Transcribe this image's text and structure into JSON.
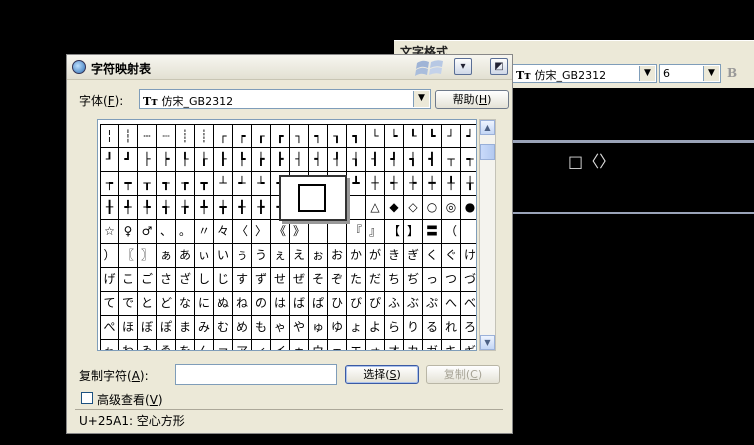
{
  "background_window": {
    "title": "文字格式",
    "font_combo": "仿宋_GB2312",
    "size_combo": "6",
    "bold_label": "B",
    "symbols": "□〈〉"
  },
  "dialog": {
    "title": "字符映射表",
    "font_label": "字体",
    "font_key": "F",
    "font_value": "仿宋_GB2312",
    "help_label": "帮助",
    "help_key": "H",
    "copy_label": "复制字符",
    "copy_key": "A",
    "copy_value": "",
    "select_label": "选择",
    "select_key": "S",
    "copy_button_label": "复制",
    "copy_button_key": "C",
    "advanced_label": "高级查看",
    "advanced_key": "V",
    "advanced_checked": false,
    "status": "U+25A1: 空心方形",
    "zoom_char": "□"
  },
  "grid": {
    "columns": 20,
    "rows": [
      [
        "╎",
        "┆",
        "┄",
        "┈",
        "┊",
        "┊",
        "┌",
        "┍",
        "┎",
        "┏",
        "┐",
        "┑",
        "┒",
        "┓",
        "└",
        "┕",
        "┖",
        "┗",
        "┘",
        "┙"
      ],
      [
        "┚",
        "┛",
        "├",
        "┝",
        "┞",
        "┟",
        "┠",
        "┡",
        "┢",
        "┣",
        "┤",
        "┥",
        "┦",
        "┧",
        "┨",
        "┩",
        "┪",
        "┫",
        "┬",
        "┭"
      ],
      [
        "┮",
        "┯",
        "┰",
        "┱",
        "┲",
        "┳",
        "┴",
        "┵",
        "┶",
        "┷",
        "┸",
        "┹",
        "┺",
        "┻",
        "┼",
        "┽",
        "┾",
        "┿",
        "╀",
        "╁"
      ],
      [
        "╂",
        "╃",
        "╄",
        "╅",
        "╆",
        "╇",
        "╈",
        "╉",
        "╊",
        "╋",
        "",
        "",
        "",
        "",
        "△",
        "◆",
        "◇",
        "○",
        "◎",
        "●",
        "★"
      ],
      [
        "☆",
        "♀",
        "♂",
        "、",
        "。",
        "〃",
        "々",
        "〈",
        "〉",
        "《",
        "》",
        "",
        "",
        "『",
        "』",
        "【",
        "】",
        "〓",
        "（"
      ],
      [
        "）",
        "〖",
        "〗",
        "ぁ",
        "あ",
        "ぃ",
        "い",
        "ぅ",
        "う",
        "ぇ",
        "え",
        "ぉ",
        "お",
        "か",
        "が",
        "き",
        "ぎ",
        "く",
        "ぐ",
        "け"
      ],
      [
        "げ",
        "こ",
        "ご",
        "さ",
        "ざ",
        "し",
        "じ",
        "す",
        "ず",
        "せ",
        "ぜ",
        "そ",
        "ぞ",
        "た",
        "だ",
        "ち",
        "ぢ",
        "っ",
        "つ",
        "づ"
      ],
      [
        "て",
        "で",
        "と",
        "ど",
        "な",
        "に",
        "ぬ",
        "ね",
        "の",
        "は",
        "ば",
        "ぱ",
        "ひ",
        "び",
        "ぴ",
        "ふ",
        "ぶ",
        "ぷ",
        "へ",
        "べ"
      ],
      [
        "ぺ",
        "ほ",
        "ぼ",
        "ぽ",
        "ま",
        "み",
        "む",
        "め",
        "も",
        "ゃ",
        "や",
        "ゅ",
        "ゆ",
        "ょ",
        "よ",
        "ら",
        "り",
        "る",
        "れ",
        "ろ"
      ],
      [
        "ゎ",
        "わ",
        "ゐ",
        "ゑ",
        "を",
        "ん",
        "ァ",
        "ア",
        "ィ",
        "イ",
        "ゥ",
        "ウ",
        "ェ",
        "エ",
        "ォ",
        "オ",
        "カ",
        "ガ",
        "キ",
        "ギ"
      ]
    ]
  }
}
